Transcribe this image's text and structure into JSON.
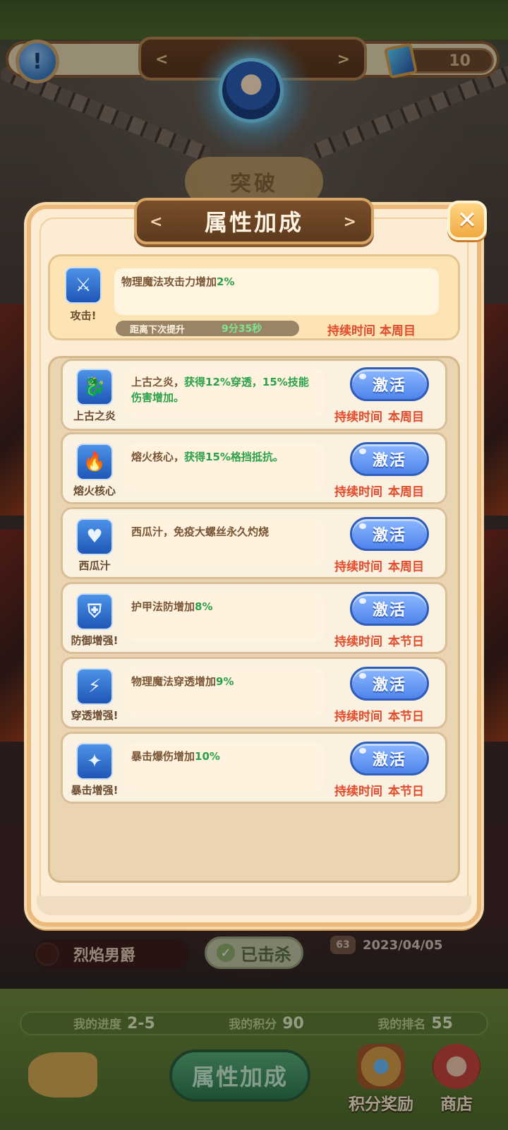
{
  "hud": {
    "alert_icon": "exclamation-icon",
    "token_count": "10",
    "breakthrough_label": "突破"
  },
  "modal": {
    "title": "属性加成",
    "close_icon": "close-icon",
    "current_buff": {
      "name": "攻击!",
      "icon": "sword-shield-icon",
      "desc_prefix": "物理魔法攻击力增加",
      "desc_highlight": "2%",
      "progress_label": "距离下次提升",
      "progress_timer": "9分35秒",
      "duration_label": "持续时间",
      "duration_value": "本周目"
    },
    "buffs": [
      {
        "name": "上古之炎",
        "icon": "dragon-icon",
        "desc_prefix": "上古之炎，",
        "desc_highlight": "获得12%穿透，15%技能伤害增加。",
        "desc_suffix": "",
        "button": "激活",
        "duration_label": "持续时间",
        "duration_value": "本周目"
      },
      {
        "name": "熔火核心",
        "icon": "flame-icon",
        "desc_prefix": "熔火核心，",
        "desc_highlight": "获得15%格挡抵抗。",
        "desc_suffix": "",
        "button": "激活",
        "duration_label": "持续时间",
        "duration_value": "本周目"
      },
      {
        "name": "西瓜汁",
        "icon": "heart-potion-icon",
        "desc_prefix": "西瓜汁，免疫大螺丝永久灼烧",
        "desc_highlight": "",
        "desc_suffix": "",
        "button": "激活",
        "duration_label": "持续时间",
        "duration_value": "本周目"
      },
      {
        "name": "防御增强!",
        "icon": "shield-icon",
        "desc_prefix": "护甲法防增加",
        "desc_highlight": "8%",
        "desc_suffix": "",
        "button": "激活",
        "duration_label": "持续时间",
        "duration_value": "本节日"
      },
      {
        "name": "穿透增强!",
        "icon": "lightning-burst-icon",
        "desc_prefix": "物理魔法穿透增加",
        "desc_highlight": "9%",
        "desc_suffix": "",
        "button": "激活",
        "duration_label": "持续时间",
        "duration_value": "本节日"
      },
      {
        "name": "暴击增强!",
        "icon": "critical-strike-icon",
        "desc_prefix": "暴击爆伤增加",
        "desc_highlight": "10%",
        "desc_suffix": "",
        "button": "激活",
        "duration_label": "持续时间",
        "duration_value": "本节日"
      }
    ]
  },
  "background": {
    "boss_name": "烈焰男爵",
    "killed_label": "已击杀",
    "boss_level": "63",
    "date": "2023/04/05"
  },
  "bottom": {
    "progress_label": "我的进度",
    "progress_value": "2-5",
    "score_label": "我的积分",
    "score_value": "90",
    "rank_label": "我的排名",
    "rank_value": "55",
    "main_button": "属性加成",
    "reward_label": "积分奖励",
    "shop_label": "商店"
  },
  "colors": {
    "highlight_green": "#2ba24a",
    "duration_red": "#e24b2c",
    "activate_blue": "#4f84ec",
    "panel_bg": "#fbecd3",
    "title_brown": "#6c4426"
  }
}
